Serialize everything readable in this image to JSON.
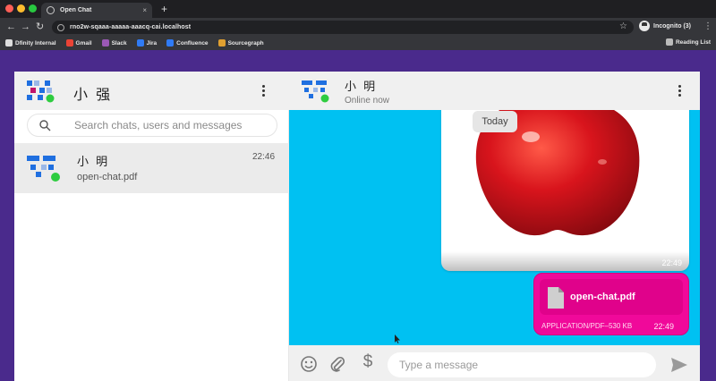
{
  "browser": {
    "tab_title": "Open Chat",
    "tab_close": "×",
    "new_tab": "+",
    "url": "rno2w-sqaaa-aaaaa-aaacq-cai.localhost",
    "profile_label": "Incognito (3)",
    "bookmarks": [
      {
        "label": "Dfinity Internal",
        "color": "#dddddd"
      },
      {
        "label": "Gmail",
        "color": "#ea4335"
      },
      {
        "label": "Slack",
        "color": "#9b59b6"
      },
      {
        "label": "Jira",
        "color": "#2f7bf5"
      },
      {
        "label": "Confluence",
        "color": "#2f7bf5"
      },
      {
        "label": "Sourcegraph",
        "color": "#e0a030"
      }
    ],
    "reading_list": "Reading List"
  },
  "sidebar": {
    "user_name": "小 强",
    "search_placeholder": "Search chats, users and messages",
    "chats": [
      {
        "name": "小 明",
        "time": "22:46",
        "last_message": "open-chat.pdf"
      }
    ]
  },
  "conversation": {
    "name": "小 明",
    "status": "Online now",
    "date_label": "Today",
    "messages": [
      {
        "type": "image",
        "time": "22:49"
      },
      {
        "type": "file",
        "file_name": "open-chat.pdf",
        "meta": "APPLICATION/PDF–530 KB",
        "time": "22:49"
      }
    ],
    "composer_placeholder": "Type a message",
    "currency_symbol": "$"
  },
  "colors": {
    "page_bg": "#4a2a8c",
    "messages_bg": "#00c1f2",
    "file_bubble": "#f0099a",
    "online": "#2ecc40",
    "avatar_blue": "#1f6fe0"
  }
}
